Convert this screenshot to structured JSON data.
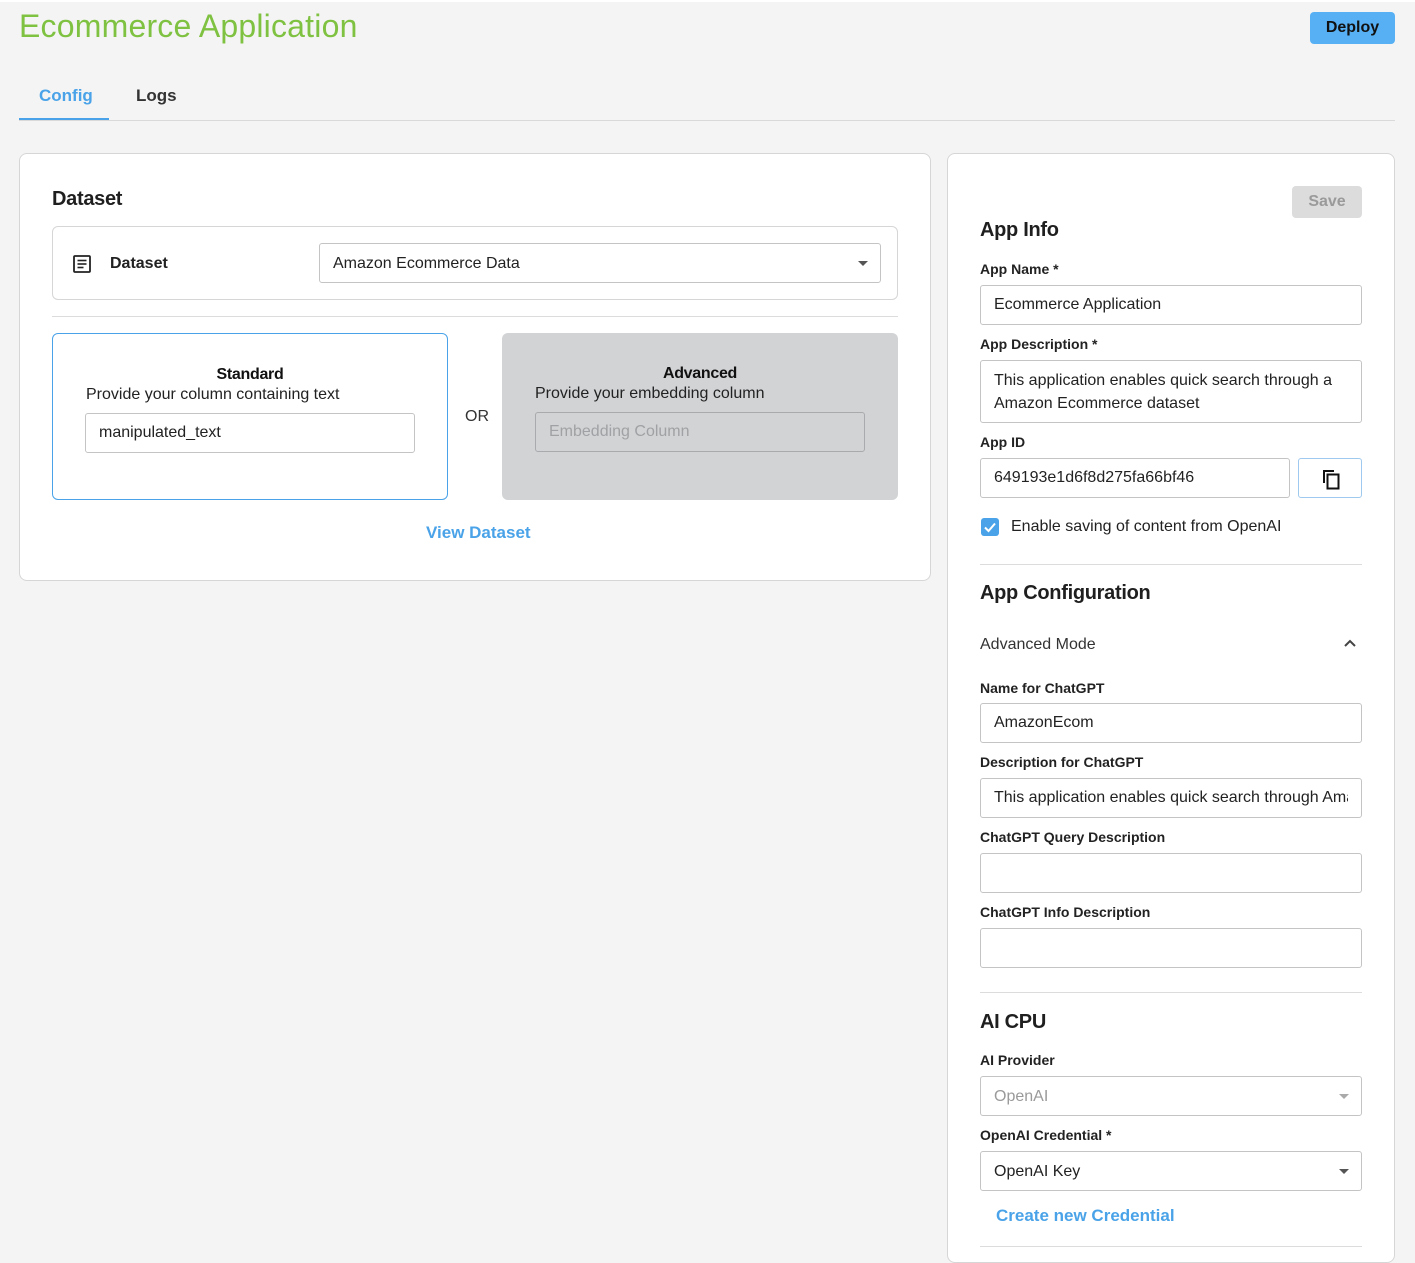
{
  "header": {
    "title": "Ecommerce Application",
    "deploy_label": "Deploy"
  },
  "tabs": [
    {
      "label": "Config",
      "active": true
    },
    {
      "label": "Logs",
      "active": false
    }
  ],
  "dataset_card": {
    "title": "Dataset",
    "dataset_label": "Dataset",
    "dataset_value": "Amazon Ecommerce Data",
    "standard": {
      "title": "Standard",
      "subtitle": "Provide your column containing text",
      "value": "manipulated_text"
    },
    "or_label": "OR",
    "advanced": {
      "title": "Advanced",
      "subtitle": "Provide your embedding column",
      "placeholder": "Embedding Column"
    },
    "view_dataset_label": "View Dataset"
  },
  "right_panel": {
    "save_label": "Save",
    "app_info": {
      "title": "App Info",
      "app_name_label": "App Name *",
      "app_name_value": "Ecommerce Application",
      "app_description_label": "App Description *",
      "app_description_value": "This application enables quick search through a Amazon Ecommerce dataset",
      "app_id_label": "App ID",
      "app_id_value": "649193e1d6f8d275fa66bf46",
      "enable_saving_label": "Enable saving of content from OpenAI",
      "enable_saving_checked": true
    },
    "app_config": {
      "title": "App Configuration",
      "advanced_mode_label": "Advanced Mode",
      "name_for_chatgpt_label": "Name for ChatGPT",
      "name_for_chatgpt_value": "AmazonEcom",
      "description_for_chatgpt_label": "Description for ChatGPT",
      "description_for_chatgpt_value": "This application enables quick search through Amazon Ecommerce dataset",
      "query_description_label": "ChatGPT Query Description",
      "query_description_value": "",
      "info_description_label": "ChatGPT Info Description",
      "info_description_value": ""
    },
    "ai_cpu": {
      "title": "AI CPU",
      "ai_provider_label": "AI Provider",
      "ai_provider_value": "OpenAI",
      "credential_label": "OpenAI Credential *",
      "credential_value": "OpenAI Key",
      "create_credential_label": "Create new Credential"
    }
  },
  "colors": {
    "title_green": "#7fc241",
    "accent_blue": "#4aa3e8",
    "deploy_blue": "#57b0f4",
    "advanced_box_gray": "#d2d3d5"
  }
}
